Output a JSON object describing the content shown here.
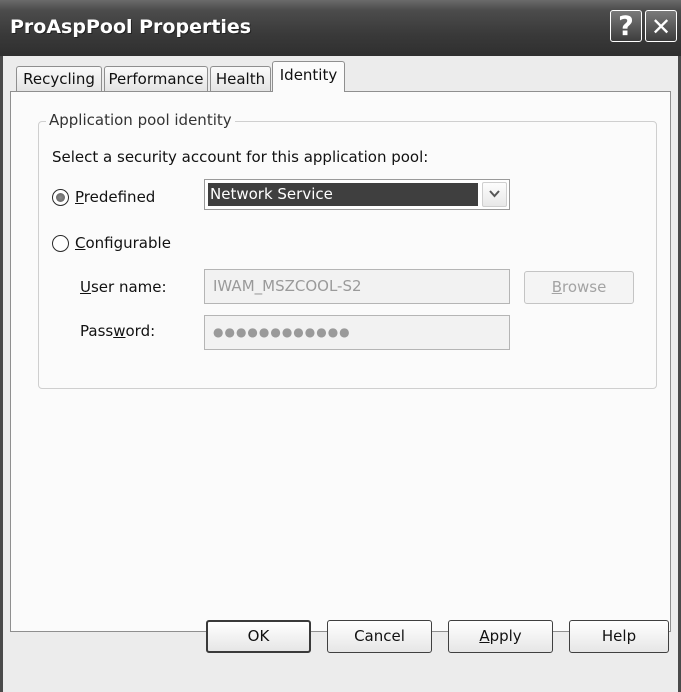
{
  "window": {
    "title": "ProAspPool Properties",
    "help_glyph": "?",
    "close_glyph": "✕"
  },
  "tabs": [
    {
      "label": "Recycling",
      "active": false
    },
    {
      "label": "Performance",
      "active": false
    },
    {
      "label": "Health",
      "active": false
    },
    {
      "label": "Identity",
      "active": true
    }
  ],
  "identity": {
    "group_label": "Application pool identity",
    "instruction": "Select a security account for this application pool:",
    "predefined": {
      "label_access": "P",
      "label_rest": "redefined",
      "checked": true,
      "selected_value": "Network Service"
    },
    "configurable": {
      "label_access": "C",
      "label_rest": "onfigurable",
      "checked": false
    },
    "username": {
      "label_access": "U",
      "label_rest": "ser name:",
      "value": "IWAM_MSZCOOL-S2"
    },
    "password": {
      "label_pre": "Pass",
      "label_access": "w",
      "label_rest": "ord:",
      "value": "●●●●●●●●●●●●"
    },
    "browse": {
      "label_access": "B",
      "label_rest": "rowse",
      "enabled": false
    }
  },
  "buttons": {
    "ok": "OK",
    "cancel": "Cancel",
    "apply_access": "A",
    "apply_rest": "pply",
    "help": "Help"
  },
  "colors": {
    "titlebar": "#3a3a3a",
    "selection": "#3f3f3f",
    "panel": "#fbfbfb"
  }
}
